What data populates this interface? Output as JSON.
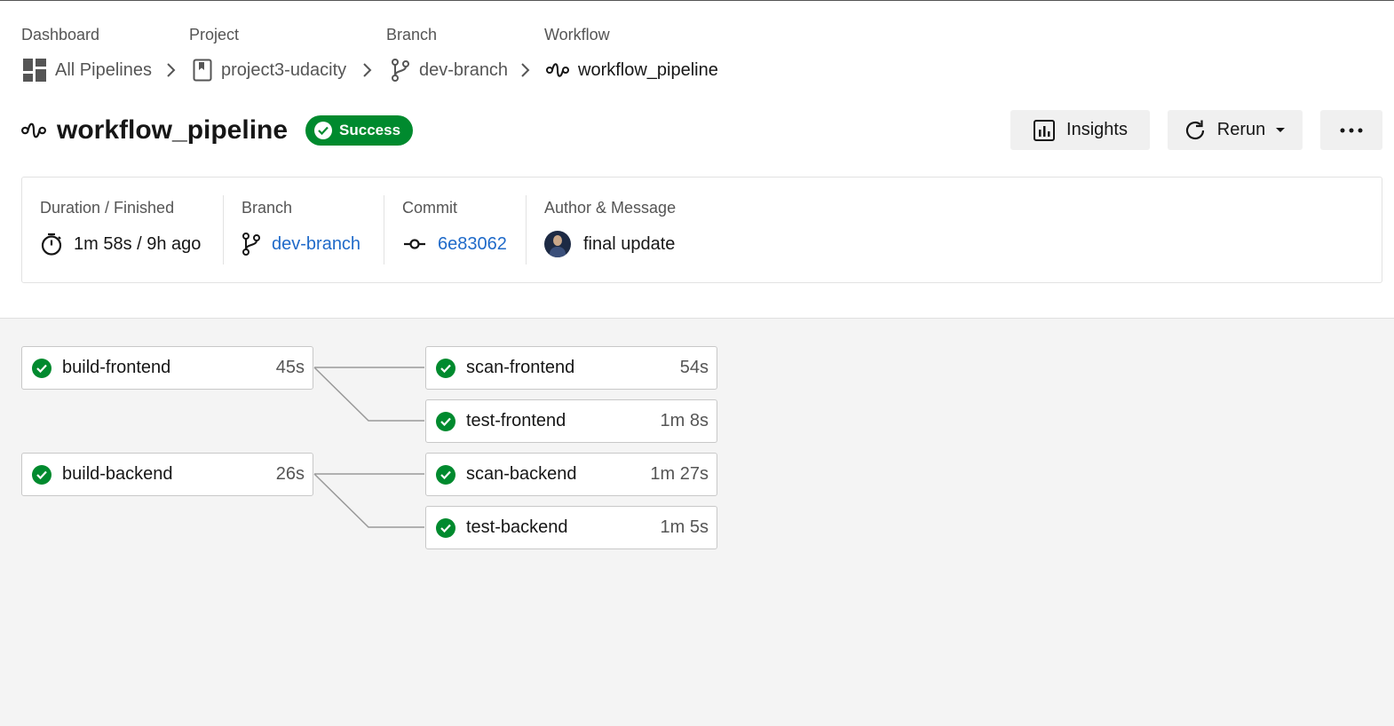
{
  "breadcrumb": {
    "dashboard": {
      "label": "Dashboard",
      "value": "All Pipelines",
      "icon": "dashboard-grid-icon"
    },
    "project": {
      "label": "Project",
      "value": "project3-udacity",
      "icon": "bookmark-icon"
    },
    "branch": {
      "label": "Branch",
      "value": "dev-branch",
      "icon": "branch-icon"
    },
    "workflow": {
      "label": "Workflow",
      "value": "workflow_pipeline",
      "icon": "workflow-icon"
    }
  },
  "header": {
    "title": "workflow_pipeline",
    "status": "Success",
    "status_color": "#008a2e",
    "insights_label": "Insights",
    "rerun_label": "Rerun"
  },
  "info": {
    "duration_label": "Duration / Finished",
    "duration_value": "1m 58s / 9h ago",
    "branch_label": "Branch",
    "branch_value": "dev-branch",
    "commit_label": "Commit",
    "commit_value": "6e83062",
    "author_label": "Author & Message",
    "message": "final update",
    "link_color": "#1f6ac9"
  },
  "jobs": {
    "build_frontend": {
      "name": "build-frontend",
      "duration": "45s"
    },
    "scan_frontend": {
      "name": "scan-frontend",
      "duration": "54s"
    },
    "test_frontend": {
      "name": "test-frontend",
      "duration": "1m 8s"
    },
    "build_backend": {
      "name": "build-backend",
      "duration": "26s"
    },
    "scan_backend": {
      "name": "scan-backend",
      "duration": "1m 27s"
    },
    "test_backend": {
      "name": "test-backend",
      "duration": "1m 5s"
    }
  }
}
